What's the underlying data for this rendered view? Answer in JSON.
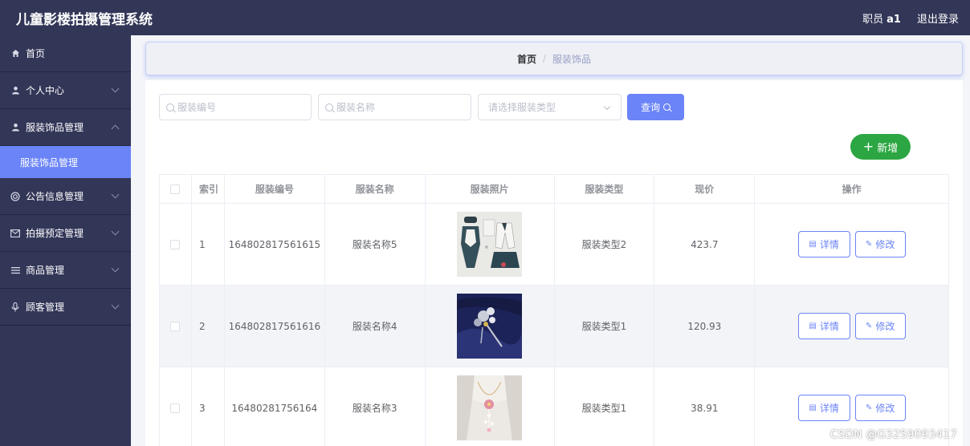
{
  "app": {
    "title": "儿童影楼拍摄管理系统"
  },
  "header": {
    "role_label": "职员",
    "username": "a1",
    "logout_label": "退出登录"
  },
  "sidebar": {
    "items": [
      {
        "label": "首页",
        "icon": "home-icon"
      },
      {
        "label": "个人中心",
        "icon": "user-icon"
      },
      {
        "label": "服装饰品管理",
        "icon": "user-icon",
        "expanded": true,
        "children": [
          {
            "label": "服装饰品管理",
            "active": true
          }
        ]
      },
      {
        "label": "公告信息管理",
        "icon": "circle-icon"
      },
      {
        "label": "拍摄预定管理",
        "icon": "mail-icon"
      },
      {
        "label": "商品管理",
        "icon": "list-icon"
      },
      {
        "label": "顾客管理",
        "icon": "mic-icon"
      }
    ]
  },
  "breadcrumb": {
    "home": "首页",
    "separator": "/",
    "current": "服装饰品"
  },
  "search": {
    "code_placeholder": "服装编号",
    "name_placeholder": "服装名称",
    "type_placeholder": "请选择服装类型",
    "query_label": "查询"
  },
  "actions": {
    "add_label": "新增"
  },
  "table": {
    "columns": [
      "索引",
      "服装编号",
      "服装名称",
      "服装照片",
      "服装类型",
      "现价",
      "操作"
    ],
    "rows": [
      {
        "index": "1",
        "code": "164802817561615",
        "name": "服装名称5",
        "photo": "clothing-photo",
        "type": "服装类型2",
        "price": "423.7"
      },
      {
        "index": "2",
        "code": "164802817561616",
        "name": "服装名称4",
        "photo": "brooch-photo",
        "type": "服装类型1",
        "price": "120.93"
      },
      {
        "index": "3",
        "code": "16480281756164",
        "name": "服装名称3",
        "photo": "necklace-photo",
        "type": "服装类型1",
        "price": "38.91"
      }
    ],
    "detail_label": "详情",
    "edit_label": "修改"
  },
  "watermark": "CSDN @G3259093417",
  "colors": {
    "nav_bg": "#323657",
    "accent": "#6b84f7",
    "success": "#2ca642"
  }
}
